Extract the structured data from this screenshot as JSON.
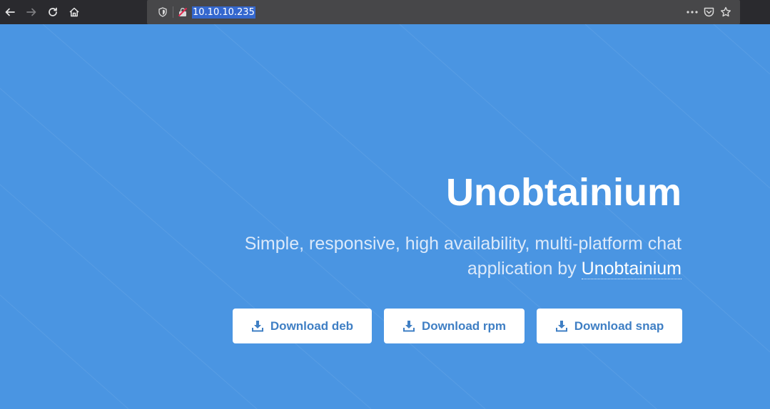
{
  "browser": {
    "url": "10.10.10.235"
  },
  "hero": {
    "title": "Unobtainium",
    "subtitle_text": "Simple, responsive, high availability, multi-platform chat application by ",
    "subtitle_brand": "Unobtainium"
  },
  "downloads": [
    {
      "label": "Download deb",
      "icon": "download-icon"
    },
    {
      "label": "Download rpm",
      "icon": "download-icon"
    },
    {
      "label": "Download snap",
      "icon": "download-icon"
    }
  ],
  "colors": {
    "background": "#4a95e2",
    "button_text": "#3f7fc4",
    "toolbar": "#2a2a2e",
    "urlbar": "#474749"
  }
}
